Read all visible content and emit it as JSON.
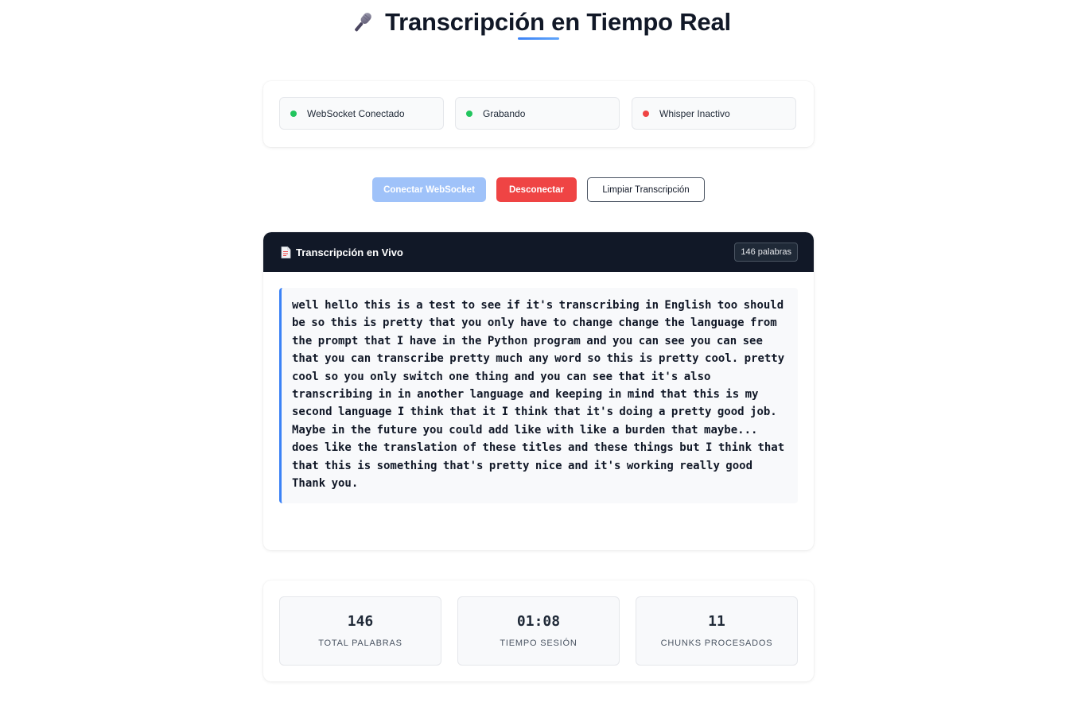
{
  "header": {
    "title": "Transcripción en Tiempo Real",
    "icon": "microphone-icon"
  },
  "status": {
    "items": [
      {
        "label": "WebSocket Conectado",
        "state": "active",
        "color": "#22c55e"
      },
      {
        "label": "Grabando",
        "state": "active",
        "color": "#22c55e"
      },
      {
        "label": "Whisper Inactivo",
        "state": "inactive",
        "color": "#ef4444"
      }
    ]
  },
  "controls": {
    "connect_label": "Conectar WebSocket",
    "disconnect_label": "Desconectar",
    "clear_label": "Limpiar Transcripción"
  },
  "transcript": {
    "icon": "document-icon",
    "title": "Transcripción en Vivo",
    "word_badge": "146 palabras",
    "text": "well hello this is a test to see if it's transcribing in English too should be so this is pretty that you only have to change change the language from the prompt that I have in the Python program and you can see you can see that you can transcribe pretty much any word so this is pretty cool. pretty cool so you only switch one thing and you can see that it's also transcribing in in another language and keeping in mind that this is my second language I think that it I think that it's doing a pretty good job. Maybe in the future you could add like with like a burden that maybe... does like the translation of these titles and these things but I think that that this is something that's pretty nice and it's working really good Thank you."
  },
  "stats": {
    "items": [
      {
        "value": "146",
        "label": "TOTAL PALABRAS"
      },
      {
        "value": "01:08",
        "label": "TIEMPO SESIÓN"
      },
      {
        "value": "11",
        "label": "CHUNKS PROCESADOS"
      }
    ]
  },
  "colors": {
    "accent": "#3b82f6",
    "danger": "#ef4444",
    "success": "#22c55e",
    "dark_header": "#111827"
  }
}
